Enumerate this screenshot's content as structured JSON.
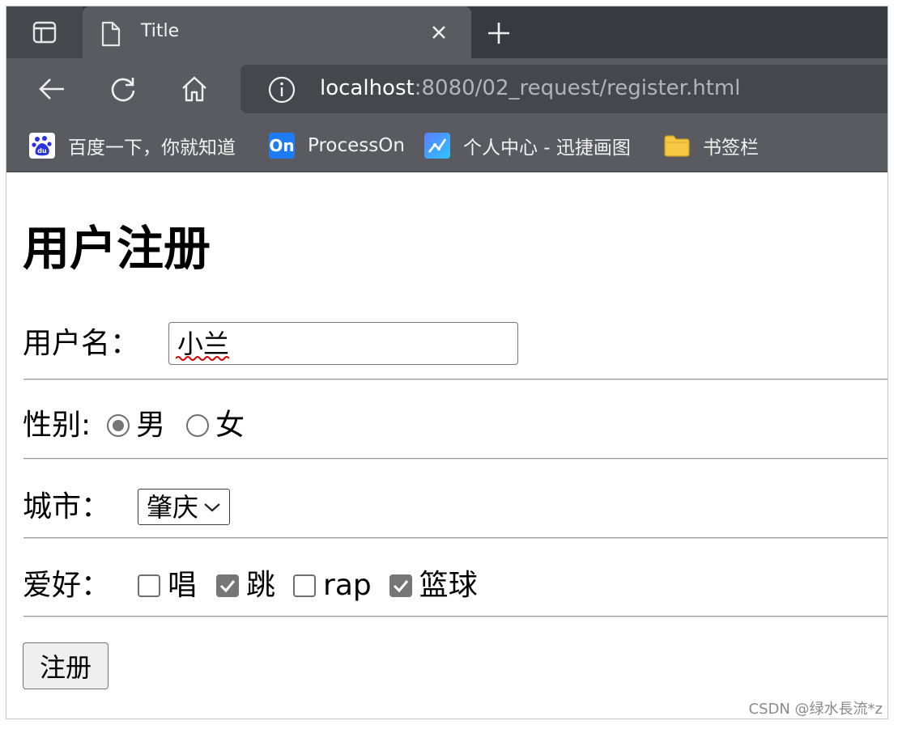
{
  "browser": {
    "tab": {
      "title": "Title"
    },
    "address": {
      "host": "localhost",
      "rest": ":8080/02_request/register.html"
    },
    "bookmarks": [
      {
        "label": "百度一下，你就知道",
        "icon": "baidu-icon"
      },
      {
        "label": "ProcessOn",
        "icon": "processon-icon",
        "icon_text": "On"
      },
      {
        "label": "个人中心 - 迅捷画图",
        "icon": "xunjie-icon"
      },
      {
        "label": "书签栏",
        "icon": "folder-icon"
      }
    ]
  },
  "form": {
    "heading": "用户注册",
    "username": {
      "label": "用户名：",
      "value": "小兰"
    },
    "gender": {
      "label": "性别:",
      "options": [
        {
          "label": "男",
          "checked": true
        },
        {
          "label": "女",
          "checked": false
        }
      ]
    },
    "city": {
      "label": "城市：",
      "selected": "肇庆"
    },
    "hobby": {
      "label": "爱好：",
      "options": [
        {
          "label": "唱",
          "checked": false
        },
        {
          "label": "跳",
          "checked": true
        },
        {
          "label": "rap",
          "checked": false
        },
        {
          "label": "篮球",
          "checked": true
        }
      ]
    },
    "submit_label": "注册"
  },
  "watermark": "CSDN @绿水長流*z",
  "colors": {
    "tabstrip": "#393a3f",
    "toolbar": "#5a5b60",
    "control_gray": "#767676",
    "squiggle": "#e00000"
  }
}
